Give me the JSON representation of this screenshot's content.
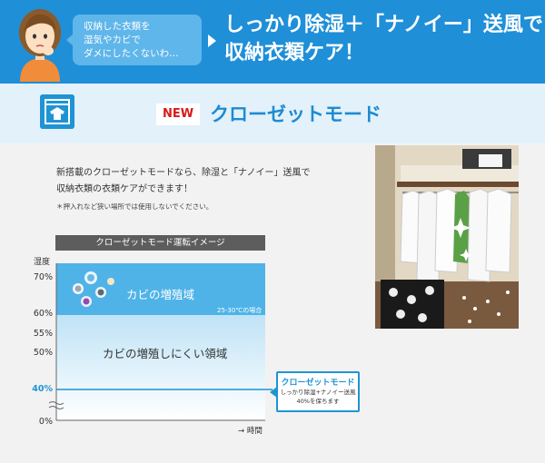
{
  "banner": {
    "bubble_lines": [
      "収納した衣類を",
      "湿気やカビで",
      "ダメにしたくないわ…"
    ],
    "headline_lines": [
      "しっかり除湿＋「ナノイー」送風で",
      "収納衣類ケア！"
    ]
  },
  "mode": {
    "badge": "NEW",
    "title": "クローゼットモード"
  },
  "description": {
    "lines": [
      "新搭載のクローゼットモードなら、除湿と「ナノイー」送風で",
      "収納衣類の衣類ケアができます！"
    ],
    "note": "＊押入れなど狭い場所では使用しないでください。"
  },
  "chart": {
    "header": "クローゼットモード運転イメージ",
    "y_title": "湿度",
    "ticks": [
      "70%",
      "60%",
      "55%",
      "50%",
      "40%",
      "0%"
    ],
    "highlight_tick": "40%",
    "x_label": "→ 時間",
    "mold_zone_label": "カビの増殖域",
    "temperature_note": "25-30℃の場合",
    "safe_zone_label": "カビの増殖しにくい領域",
    "callout": {
      "title": "クローゼットモード",
      "lines": [
        "しっかり除湿+ナノイー送風",
        "40%を保ちます"
      ]
    }
  },
  "chart_data": {
    "type": "area",
    "title": "クローゼットモード運転イメージ",
    "ylabel": "湿度",
    "xlabel": "時間",
    "y_ticks": [
      0,
      40,
      50,
      55,
      60,
      70
    ],
    "regions": [
      {
        "name": "カビの増殖域",
        "y_from": 60,
        "y_to": 73,
        "note": "25-30℃の場合"
      },
      {
        "name": "カビの増殖しにくい領域",
        "y_from": 0,
        "y_to": 60
      }
    ],
    "target_line": {
      "name": "クローゼットモード",
      "value": 40
    }
  },
  "colors": {
    "accent": "#1e94d4",
    "banner": "#1f8fd8",
    "mold_zone": "#4fb3e8",
    "new_badge_text": "#d9181a"
  }
}
